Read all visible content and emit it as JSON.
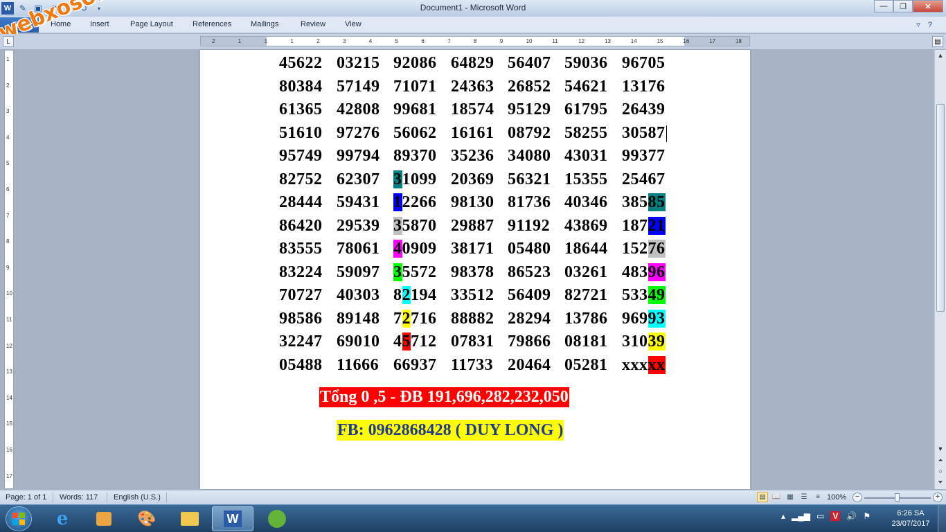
{
  "window": {
    "title": "Document1  -  Microsoft Word"
  },
  "watermark": "webxoso.net",
  "ribbon": {
    "file_tab": "File",
    "tabs": [
      "Home",
      "Insert",
      "Page Layout",
      "References",
      "Mailings",
      "Review",
      "View"
    ]
  },
  "ruler": {
    "horizontal": [
      "2",
      "1",
      "1",
      "1",
      "2",
      "3",
      "4",
      "5",
      "6",
      "7",
      "8",
      "9",
      "10",
      "11",
      "12",
      "13",
      "14",
      "15",
      "16",
      "17",
      "18"
    ],
    "vertical": [
      "1",
      "2",
      "3",
      "4",
      "5",
      "6",
      "7",
      "8",
      "9",
      "10",
      "11",
      "12",
      "13",
      "14",
      "15",
      "16",
      "17"
    ]
  },
  "document": {
    "rows": [
      [
        "45622",
        "03215",
        "92086",
        "64829",
        "56407",
        "59036",
        "96705"
      ],
      [
        "80384",
        "57149",
        "71071",
        "24363",
        "26852",
        "54621",
        "13176"
      ],
      [
        "61365",
        "42808",
        "99681",
        "18574",
        "95129",
        "61795",
        "26439"
      ],
      [
        "51610",
        "97276",
        "56062",
        "16161",
        "08792",
        "58255",
        "30587"
      ],
      [
        "95749",
        "99794",
        "89370",
        "35236",
        "34080",
        "43031",
        "99377"
      ],
      [
        "82752",
        "62307",
        "31099",
        "20369",
        "56321",
        "15355",
        "25467"
      ],
      [
        "28444",
        "59431",
        "12266",
        "98130",
        "81736",
        "40346",
        "38585"
      ],
      [
        "86420",
        "29539",
        "35870",
        "29887",
        "91192",
        "43869",
        "18721"
      ],
      [
        "83555",
        "78061",
        "40909",
        "38171",
        "05480",
        "18644",
        "15276"
      ],
      [
        "83224",
        "59097",
        "35572",
        "98378",
        "86523",
        "03261",
        "48396"
      ],
      [
        "70727",
        "40303",
        "82194",
        "33512",
        "56409",
        "82721",
        "53349"
      ],
      [
        "98586",
        "89148",
        "72716",
        "88882",
        "28294",
        "13786",
        "96993"
      ],
      [
        "32247",
        "69010",
        "45712",
        "07831",
        "79866",
        "08181",
        "31039"
      ],
      [
        "05488",
        "11666",
        "66937",
        "11733",
        "20464",
        "05281",
        "xxxxx"
      ]
    ],
    "highlights": [
      {
        "row": 5,
        "col": 2,
        "start": 0,
        "len": 1,
        "color": "#008080"
      },
      {
        "row": 6,
        "col": 2,
        "start": 0,
        "len": 1,
        "color": "#0000ff"
      },
      {
        "row": 6,
        "col": 6,
        "start": 3,
        "len": 2,
        "color": "#008080"
      },
      {
        "row": 7,
        "col": 2,
        "start": 0,
        "len": 1,
        "color": "#c0c0c0"
      },
      {
        "row": 7,
        "col": 6,
        "start": 3,
        "len": 2,
        "color": "#0000ff"
      },
      {
        "row": 8,
        "col": 2,
        "start": 0,
        "len": 1,
        "color": "#ff00ff"
      },
      {
        "row": 8,
        "col": 6,
        "start": 3,
        "len": 2,
        "color": "#c0c0c0"
      },
      {
        "row": 9,
        "col": 2,
        "start": 0,
        "len": 1,
        "color": "#00ff00"
      },
      {
        "row": 9,
        "col": 6,
        "start": 3,
        "len": 2,
        "color": "#ff00ff"
      },
      {
        "row": 10,
        "col": 2,
        "start": 1,
        "len": 1,
        "color": "#00ffff"
      },
      {
        "row": 10,
        "col": 6,
        "start": 3,
        "len": 2,
        "color": "#00ff00"
      },
      {
        "row": 11,
        "col": 2,
        "start": 1,
        "len": 1,
        "color": "#ffff00"
      },
      {
        "row": 11,
        "col": 6,
        "start": 3,
        "len": 2,
        "color": "#00ffff"
      },
      {
        "row": 12,
        "col": 2,
        "start": 1,
        "len": 1,
        "color": "#ff0000"
      },
      {
        "row": 12,
        "col": 6,
        "start": 3,
        "len": 2,
        "color": "#ffff00"
      },
      {
        "row": 13,
        "col": 6,
        "start": 3,
        "len": 2,
        "color": "#ff0000"
      }
    ],
    "summary": "Tổng 0 ,5  - ĐB 191,696,282,232,050",
    "contact": "FB: 0962868428 ( DUY LONG )"
  },
  "statusbar": {
    "page": "Page: 1 of 1",
    "words": "Words: 117",
    "language": "English (U.S.)",
    "zoom": "100%"
  },
  "taskbar": {
    "clock_time": "6:26 SA",
    "clock_date": "23/07/2017"
  }
}
